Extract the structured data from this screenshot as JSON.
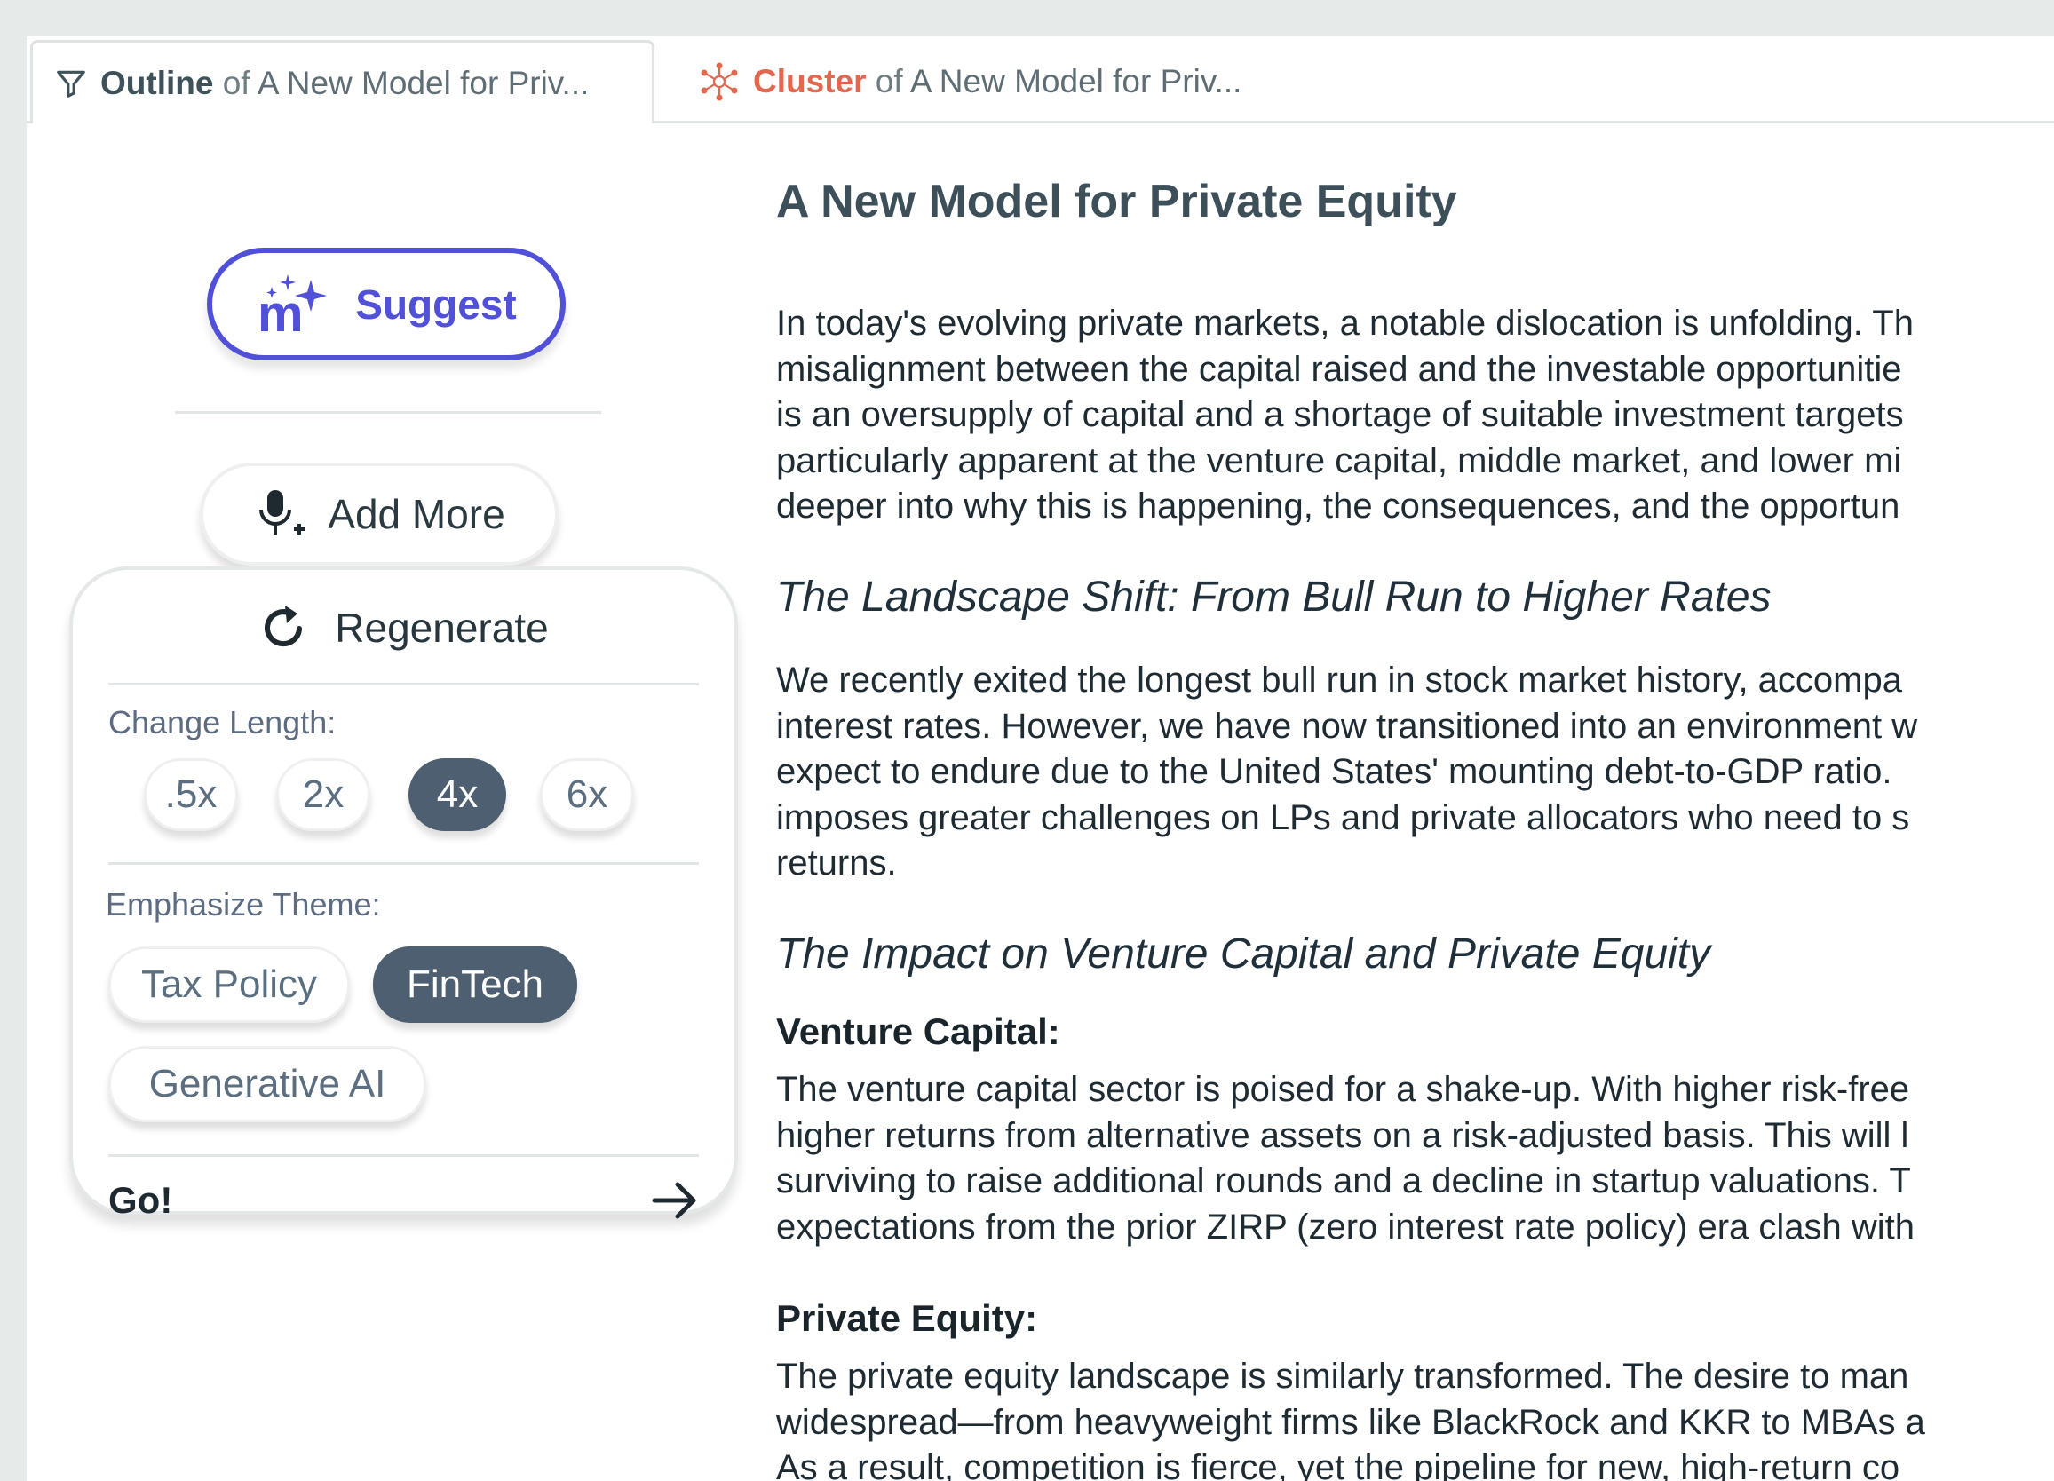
{
  "tabs": [
    {
      "type": "Outline",
      "of": "of",
      "doc": "A New Model for Priv..."
    },
    {
      "type": "Cluster",
      "of": "of",
      "doc": "A New Model for Priv..."
    }
  ],
  "panel": {
    "suggest_label": "Suggest",
    "add_more_label": "Add More",
    "regenerate": {
      "title": "Regenerate",
      "change_length_label": "Change Length:",
      "lengths": [
        ".5x",
        "2x",
        "4x",
        "6x"
      ],
      "selected_length": "4x",
      "emphasize_label": "Emphasize Theme:",
      "themes": [
        "Tax Policy",
        "FinTech",
        "Generative AI"
      ],
      "selected_theme": "FinTech",
      "go_label": "Go!"
    }
  },
  "document": {
    "title": "A New Model for Private Equity",
    "intro": [
      "In today's evolving private markets, a notable dislocation is unfolding. Th",
      "misalignment between the capital raised and the investable opportunitie",
      "is an oversupply of capital and a shortage of suitable investment targets",
      "particularly apparent at the venture capital, middle market, and lower mi",
      "deeper into why this is happening, the consequences, and the opportun"
    ],
    "section1_heading": "The Landscape Shift: From Bull Run to Higher Rates",
    "section1_body": [
      "We recently exited the longest bull run in stock market history, accompa",
      "interest rates. However, we have now transitioned into an environment w",
      "expect to endure due to the United States' mounting debt-to-GDP ratio.",
      "imposes greater challenges on LPs and private allocators who need to s",
      "returns."
    ],
    "section2_heading": "The Impact on Venture Capital and Private Equity",
    "vc_heading": "Venture Capital:",
    "vc_body": [
      "The venture capital sector is poised for a shake-up. With higher risk-free",
      "higher returns from alternative assets on a risk-adjusted basis. This will l",
      "surviving to raise additional rounds and a decline in startup valuations. T",
      "expectations from the prior ZIRP (zero interest rate policy) era clash with"
    ],
    "pe_heading": "Private Equity:",
    "pe_body": [
      "The private equity landscape is similarly transformed. The desire to man",
      "widespread—from heavyweight firms like BlackRock and KKR to MBAs a",
      "As a result, competition is fierce, yet the pipeline for new, high-return co"
    ]
  },
  "colors": {
    "accent": "#5150d9",
    "cluster": "#e1674e",
    "selected_pill": "#4d5f71"
  },
  "icons": [
    "filter-icon",
    "cluster-icon",
    "magic-m-sparkle-icon",
    "microphone-plus-icon",
    "refresh-icon",
    "arrow-right-icon"
  ]
}
